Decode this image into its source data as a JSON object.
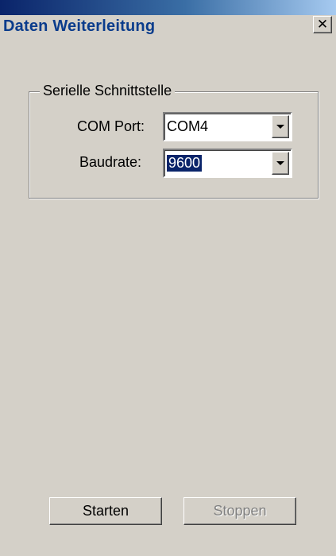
{
  "window": {
    "title": "Daten Weiterleitung",
    "close_glyph": "✕"
  },
  "serial_group": {
    "legend": "Serielle Schnittstelle",
    "com_port": {
      "label": "COM Port:",
      "value": "COM4"
    },
    "baudrate": {
      "label": "Baudrate:",
      "value": "9600"
    }
  },
  "buttons": {
    "start_label": "Starten",
    "stop_label": "Stoppen",
    "stop_disabled": true
  },
  "colors": {
    "face": "#d4d0c8",
    "title_text": "#0a3c8c",
    "selection": "#0a246a"
  }
}
